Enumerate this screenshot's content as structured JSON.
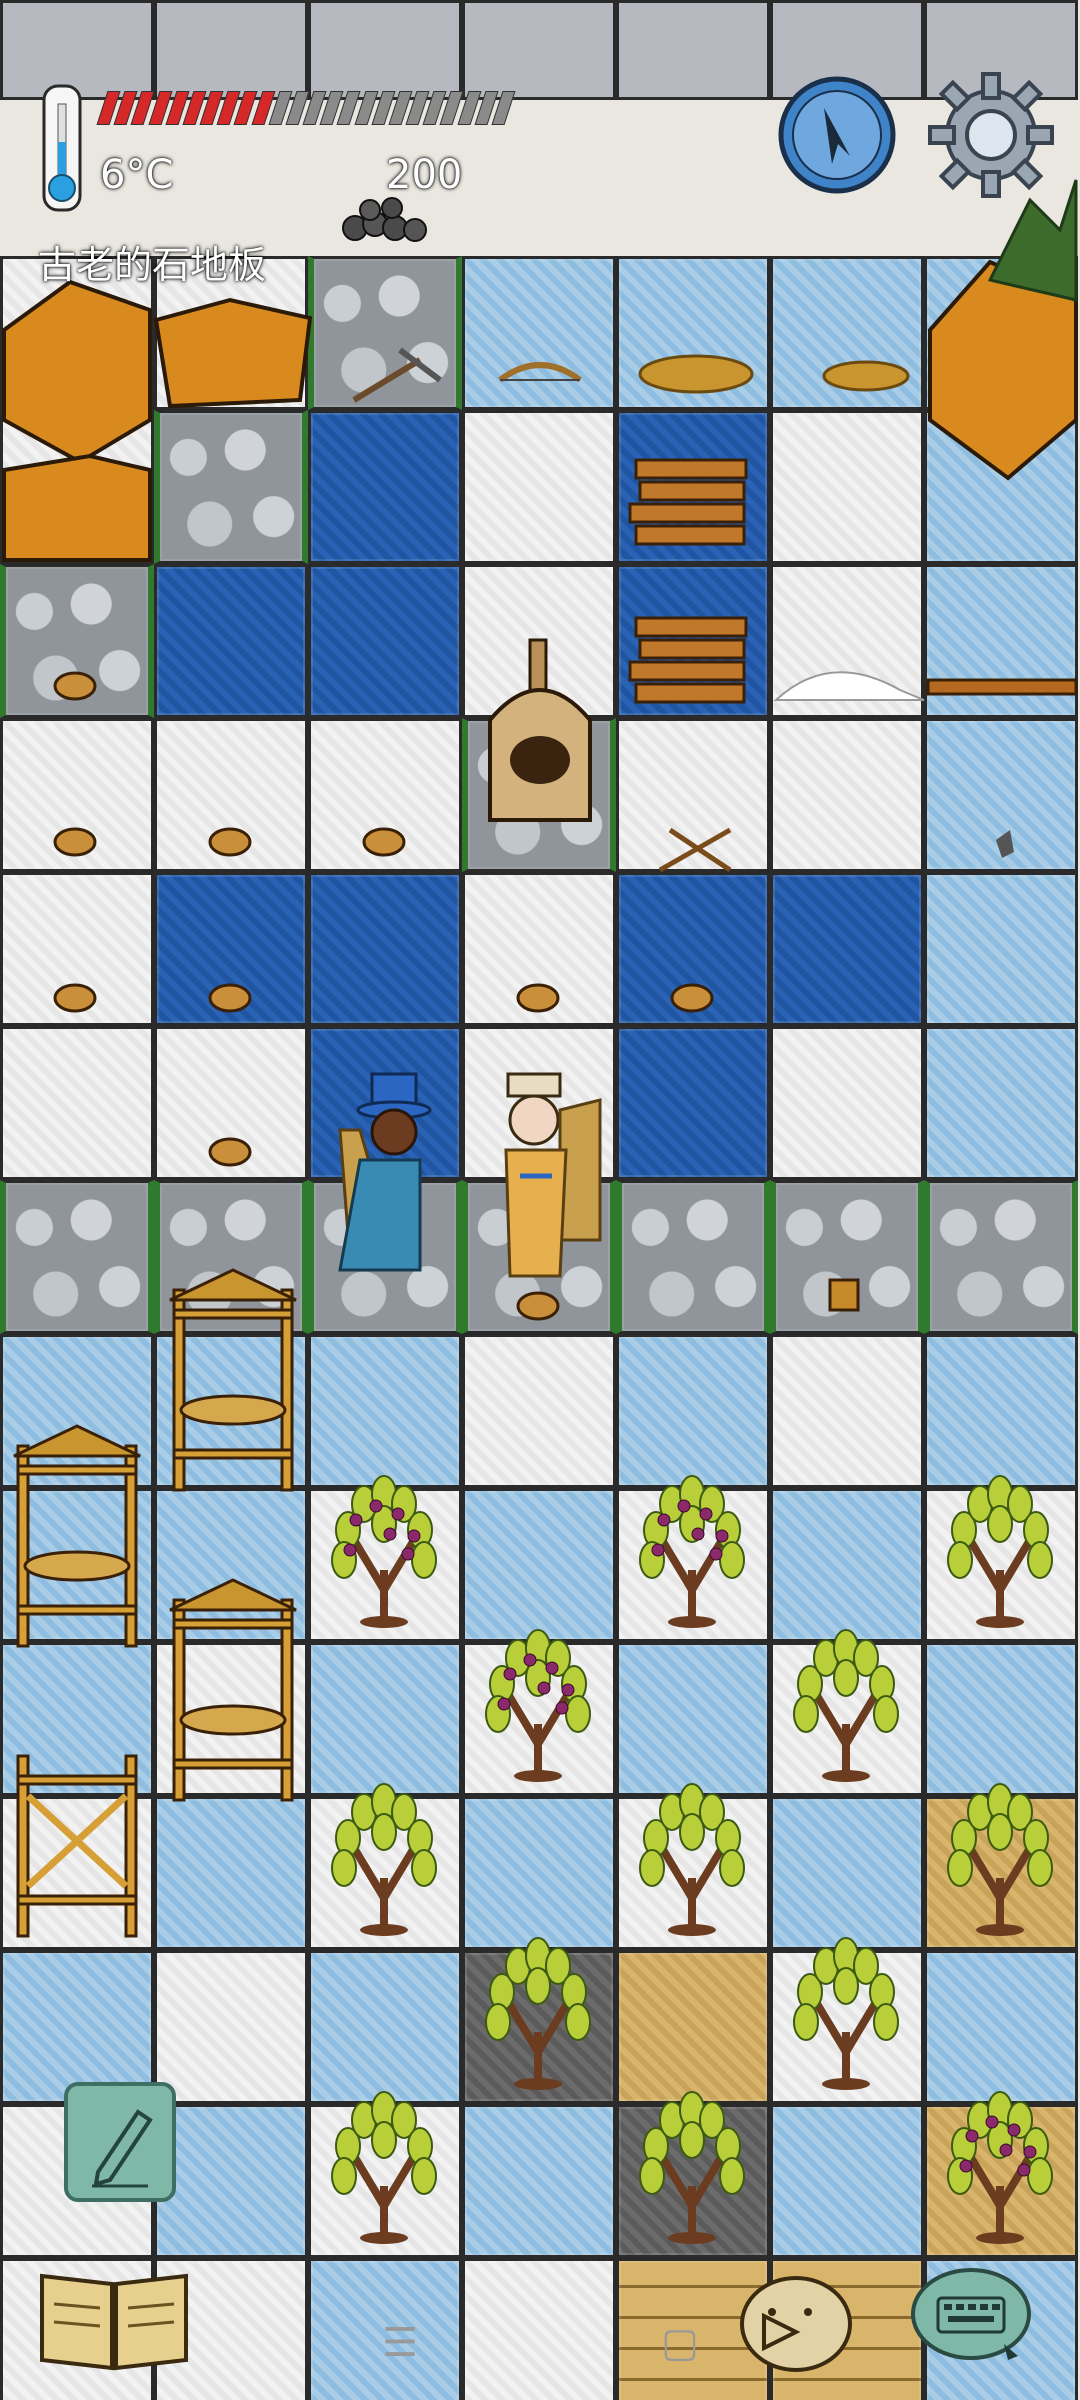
{
  "hud": {
    "temperature": "6°C",
    "count": "200",
    "tile_name": "古老的石地板",
    "food_pips_total": 24,
    "food_pips_filled": 10
  },
  "colors": {
    "food_filled": "#d62828",
    "food_empty": "#8a8a8a",
    "compass_blue": "#3f83c9",
    "gear_gray": "#9aa7b3",
    "pencil_teal": "#7fb8a6"
  },
  "icons": [
    "thermometer-icon",
    "coal-pile-icon",
    "compass-icon",
    "gear-icon",
    "pencil-icon",
    "book-icon",
    "chat-bubble-icon",
    "keyboard-icon"
  ],
  "nav": {
    "menu_glyph": "☰",
    "home_glyph": "▢"
  }
}
